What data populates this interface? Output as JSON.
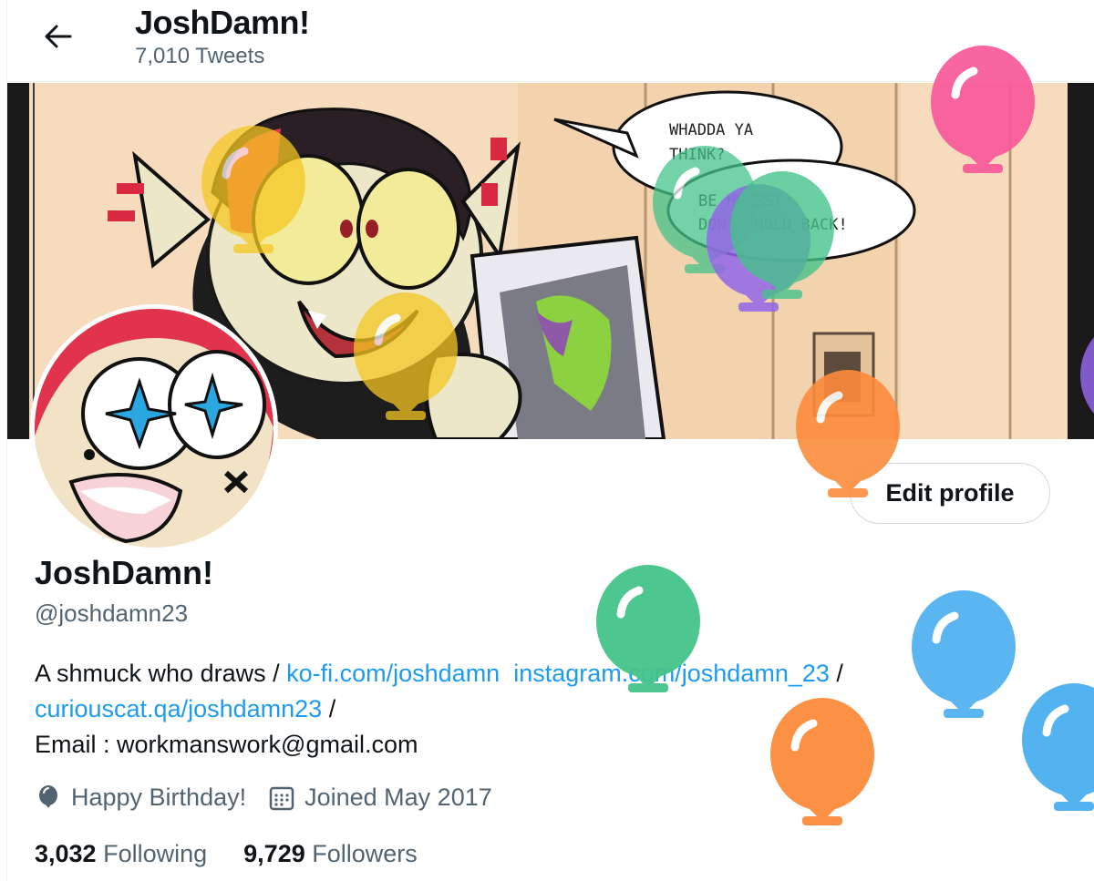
{
  "header": {
    "title": "JoshDamn!",
    "tweet_count": "7,010 Tweets"
  },
  "banner": {
    "bubble_1": [
      "WHADDA YA",
      "THINK?"
    ],
    "bubble_2": [
      "BE HONEST",
      "DON'T HOLD BACK!"
    ]
  },
  "profile": {
    "edit_label": "Edit profile",
    "name": "JoshDamn!",
    "handle": "@joshdamn23",
    "bio_text_1": "A shmuck who draws / ",
    "bio_link_1": "ko-fi.com/joshdamn",
    "bio_link_2": "instagram.com/joshdamn_23",
    "bio_sep_1": " /",
    "bio_link_3": "curiouscat.qa/joshdamn23",
    "bio_sep_2": " /",
    "bio_email": "Email : workmanswork@gmail.com",
    "birthday": "Happy Birthday!",
    "joined": "Joined May 2017"
  },
  "stats": {
    "following_count": "3,032",
    "following_label": "Following",
    "followers_count": "9,729",
    "followers_label": "Followers"
  },
  "icons": {
    "back": "arrow-left-icon",
    "birthday": "balloon-icon",
    "joined": "calendar-icon"
  },
  "colors": {
    "link": "#1d9bf0",
    "secondary_text": "#536471",
    "balloon_pink": "#f95d9c",
    "balloon_green": "#45c38a",
    "balloon_orange": "#fc8c3c",
    "balloon_blue": "#4aaef0",
    "balloon_yellow": "#f5c722",
    "balloon_purple": "#9266e8"
  }
}
